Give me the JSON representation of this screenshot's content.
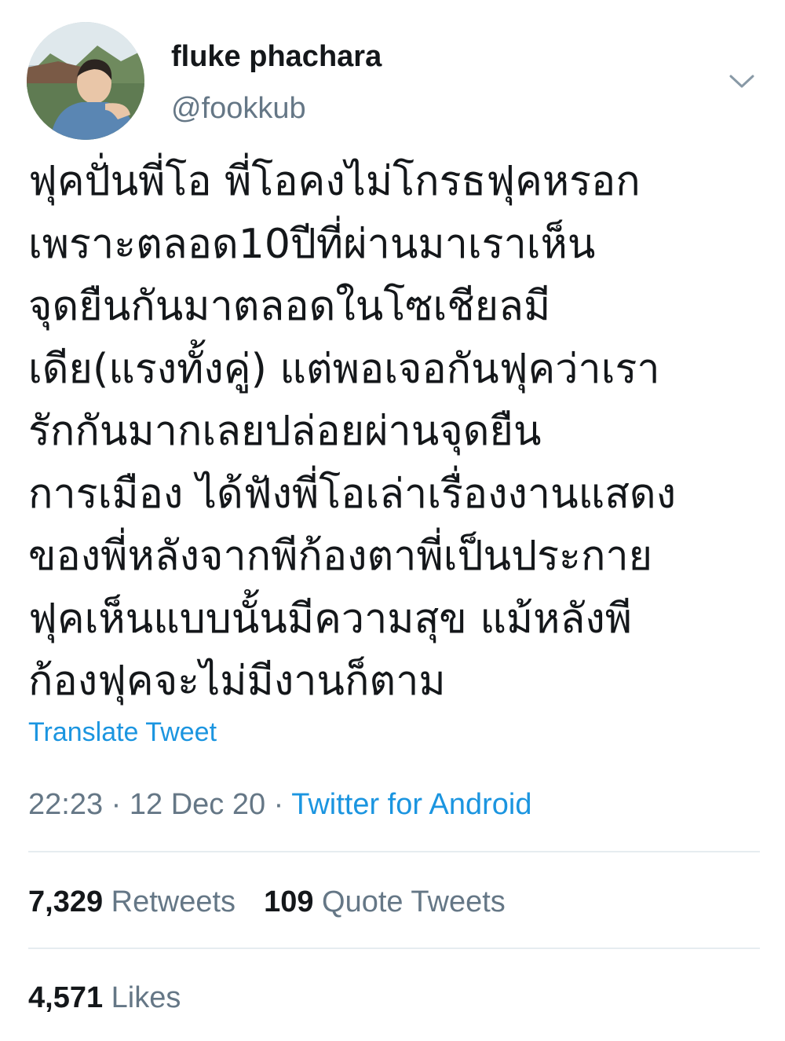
{
  "user": {
    "display_name": "fluke phachara",
    "handle": "@fookkub",
    "avatar_icon": "profile-photo"
  },
  "tweet": {
    "lines": [
      "ฟุคปั่นพี่โอ พี่โอคงไม่โกรธฟุคหรอก",
      "เพราะตลอด10ปีที่ผ่านมาเราเห็น",
      "จุดยืนกันมาตลอดในโซเชียลมี",
      "เดีย(แรงทั้งคู่) แต่พอเจอกันฟุคว่าเรา",
      "รักกันมากเลยปล่อยผ่านจุดยืน",
      "การเมือง ได้ฟังพี่โอเล่าเรื่องงานแสดง",
      "ของพี่หลังจากพีก้องตาพี่เป็นประกาย",
      "ฟุคเห็นแบบนั้นมีความสุข แม้หลังพี",
      "ก้องฟุคจะไม่มีงานก็ตาม"
    ],
    "translate_label": "Translate Tweet"
  },
  "meta": {
    "time": "22:23",
    "separator": " · ",
    "date": "12 Dec 20",
    "source": "Twitter for Android"
  },
  "stats": {
    "retweets_count": "7,329",
    "retweets_label": " Retweets",
    "quotes_count": "109",
    "quotes_label": " Quote Tweets",
    "likes_count": "4,571",
    "likes_label": " Likes"
  },
  "colors": {
    "text": "#14171a",
    "muted": "#657786",
    "link": "#1b95e0",
    "divider": "#e6ecf0"
  },
  "icons": {
    "caret": "chevron-down-icon"
  }
}
